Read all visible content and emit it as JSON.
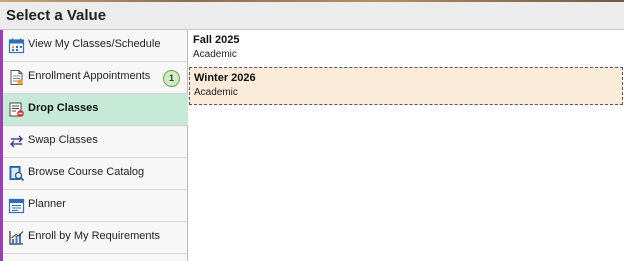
{
  "dialog": {
    "title": "Select a Value"
  },
  "sidebar": {
    "items": [
      {
        "label": "View My Classes/Schedule",
        "icon": "calendar-icon",
        "active": false
      },
      {
        "label": "Enrollment Appointments",
        "icon": "appointment-icon",
        "active": false,
        "badge": "1"
      },
      {
        "label": "Drop Classes",
        "icon": "drop-icon",
        "active": true
      },
      {
        "label": "Swap Classes",
        "icon": "swap-icon",
        "active": false
      },
      {
        "label": "Browse Course Catalog",
        "icon": "catalog-search-icon",
        "active": false
      },
      {
        "label": "Planner",
        "icon": "planner-icon",
        "active": false
      },
      {
        "label": "Enroll by My Requirements",
        "icon": "chart-icon",
        "active": false
      }
    ]
  },
  "terms": [
    {
      "name": "Fall 2025",
      "career": "Academic",
      "selected": false
    },
    {
      "name": "Winter 2026",
      "career": "Academic",
      "selected": true
    }
  ],
  "colors": {
    "active_nav": "#c7e9d8",
    "selected_row": "#fbecd9",
    "accent_bar": "#9b3fb5"
  }
}
